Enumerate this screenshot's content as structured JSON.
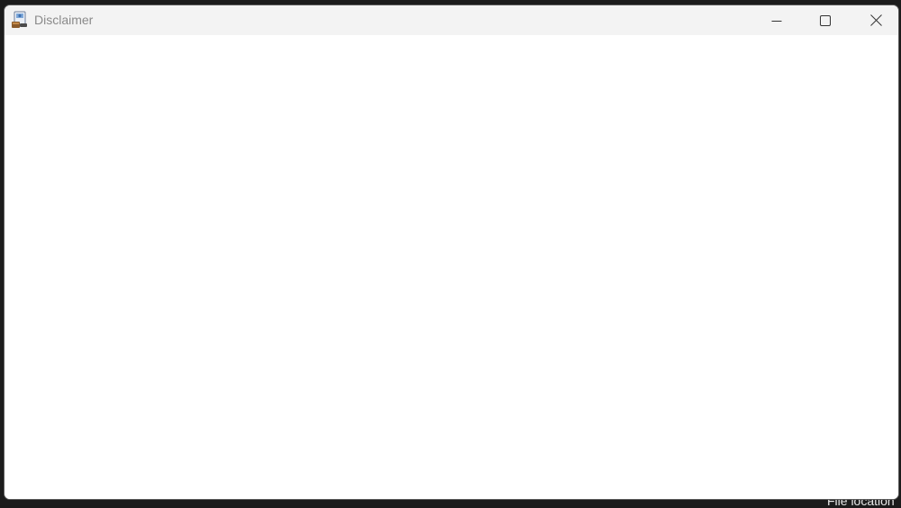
{
  "window": {
    "title": "Disclaimer",
    "app_icon": "installer-icon"
  },
  "caption_buttons": {
    "minimize": "minimize-icon",
    "maximize": "maximize-icon",
    "close": "close-icon"
  },
  "background": {
    "partial_text": "File location"
  },
  "colors": {
    "titlebar": "#f3f3f3",
    "content": "#ffffff",
    "desktop": "#1c1c1c",
    "title_text": "#8a8a8a"
  }
}
